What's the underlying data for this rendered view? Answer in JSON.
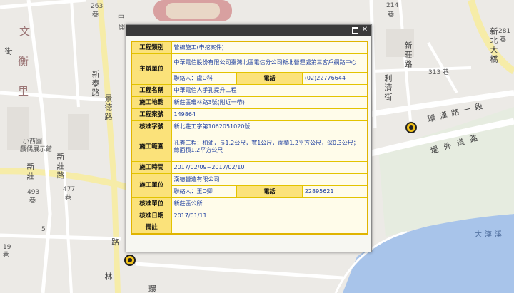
{
  "map": {
    "labels": {
      "wen": "文",
      "heng": "衡",
      "li": "里",
      "zhong": "中",
      "kai": "開",
      "lane_263": "263",
      "lane_214": "214",
      "xiang_a": "巷",
      "xiang_b": "巷",
      "xiang_313": "巷",
      "xiang_281": "巷",
      "num_313": "313",
      "num_281": "281",
      "num_493": "493",
      "num_477": "477",
      "num_19": "19",
      "num_5": "5",
      "xinzhuang_top": "新莊路",
      "xintai_road": "新泰路",
      "jingde_road": "景德路",
      "xinzhuang_left": "新莊路",
      "xiaoxiguan": "小西園",
      "guiguan": "戲偶展示館",
      "lijiwei": "利濟街",
      "huanhan_road": "環漢路一段",
      "tiwai_road": "堤外道路",
      "xinbei_ave": "新北大橋",
      "dahan_creek": "大漢溪",
      "xinfu_road": "新莊",
      "xiang_ll": "巷",
      "xiang_l2": "巷",
      "xiang_l3": "巷",
      "jie_l": "街",
      "zhu_l": "路",
      "lin_road": "林",
      "huan_l": "環",
      "road_cut": "路"
    }
  },
  "popup": {
    "rows": {
      "type": {
        "label": "工程類別",
        "value": "管線施工(申挖案件)"
      },
      "owner": {
        "label": "主辦單位",
        "value": "中華電信股份有限公司臺灣北區電信分公司新北營運處第三客戶網路中心",
        "contact_label": "聯絡人：",
        "contact_value": "盧O科",
        "phone_label": "電話",
        "phone_value": "(02)22776644"
      },
      "name": {
        "label": "工程名稱",
        "value": "中華電信人手孔提升工程"
      },
      "location": {
        "label": "施工地點",
        "value": "新莊區瓊林路3號(附近一帶)"
      },
      "case_no": {
        "label": "工程案號",
        "value": "149864"
      },
      "permit": {
        "label": "核准字號",
        "value": "新北莊工字第1062051020號"
      },
      "scope": {
        "label": "施工範圍",
        "line1": "孔蓋工程：柏油，長1.2公尺，寬1公尺，面積1.2平方公尺，深0.3公尺；",
        "line2": "總面積1.2平方公尺"
      },
      "period": {
        "label": "施工時間",
        "value": "2017/02/09~2017/02/10"
      },
      "contractor": {
        "label": "施工單位",
        "value": "漢德營造有限公司",
        "contact_label": "聯絡人：",
        "contact_value": "王O卿",
        "phone_label": "電話",
        "phone_value": "22895621"
      },
      "approver": {
        "label": "核准單位",
        "value": "新莊區公所"
      },
      "approve_date": {
        "label": "核准日期",
        "value": "2017/01/11"
      },
      "remark": {
        "label": "備註",
        "value": ""
      }
    }
  }
}
